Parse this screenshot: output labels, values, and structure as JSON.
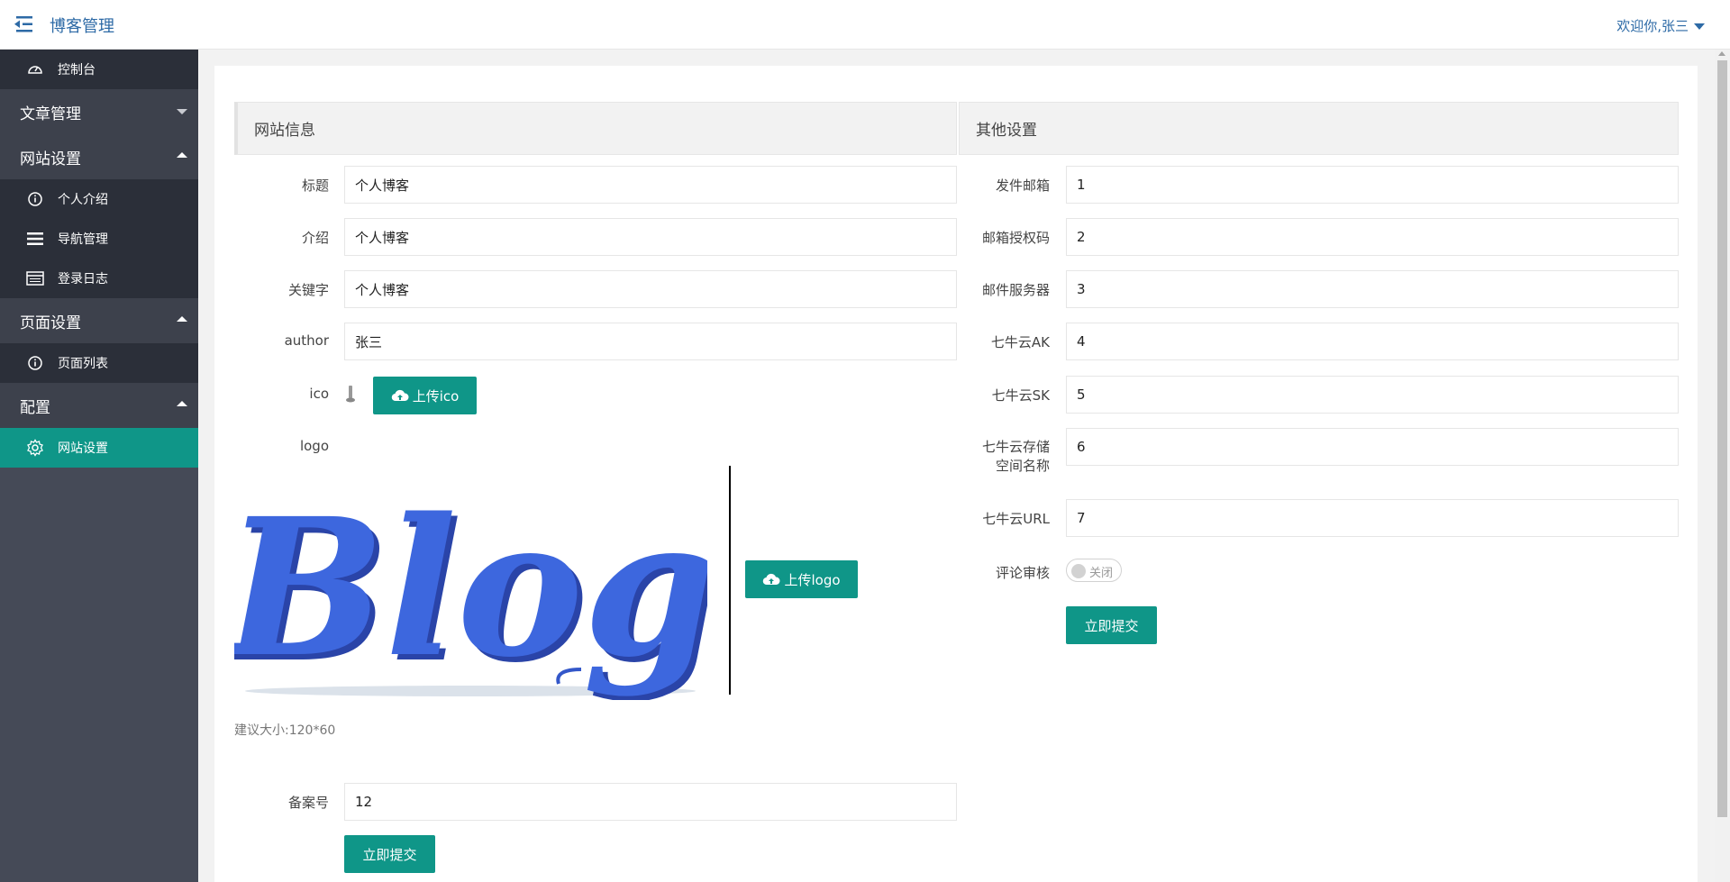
{
  "header": {
    "brand": "博客管理",
    "user": "欢迎你,张三"
  },
  "sidebar": {
    "dashboard": "控制台",
    "groups": [
      {
        "label": "文章管理",
        "expanded": false,
        "items": []
      },
      {
        "label": "网站设置",
        "expanded": true,
        "items": [
          "个人介绍",
          "导航管理",
          "登录日志"
        ]
      },
      {
        "label": "页面设置",
        "expanded": true,
        "items": [
          "页面列表"
        ]
      },
      {
        "label": "配置",
        "expanded": true,
        "items": [
          "网站设置"
        ]
      }
    ]
  },
  "site_info": {
    "heading": "网站信息",
    "fields": [
      {
        "label": "标题",
        "value": "个人博客"
      },
      {
        "label": "介绍",
        "value": "个人博客"
      },
      {
        "label": "关键字",
        "value": "个人博客"
      },
      {
        "label": "author",
        "value": "张三"
      }
    ],
    "ico_label": "ico",
    "upload_ico": "上传ico",
    "logo_label": "logo",
    "logo_text": "Blog",
    "upload_logo": "上传logo",
    "hint": "建议大小:120*60",
    "beian_label": "备案号",
    "beian_value": "12",
    "submit": "立即提交"
  },
  "other": {
    "heading": "其他设置",
    "fields": [
      {
        "label": "发件邮箱",
        "value": "1"
      },
      {
        "label": "邮箱授权码",
        "value": "2"
      },
      {
        "label": "邮件服务器",
        "value": "3"
      },
      {
        "label": "七牛云AK",
        "value": "4"
      },
      {
        "label": "七牛云SK",
        "value": "5"
      },
      {
        "label_line1": "七牛云存储",
        "label_line2": "空间名称",
        "value": "6"
      },
      {
        "label": "七牛云URL",
        "value": "7"
      }
    ],
    "comment_label": "评论审核",
    "comment_state": "关闭",
    "submit": "立即提交"
  },
  "colors": {
    "accent": "#0f9688",
    "sidebar": "#454a57",
    "brand": "#2d6aa6"
  }
}
